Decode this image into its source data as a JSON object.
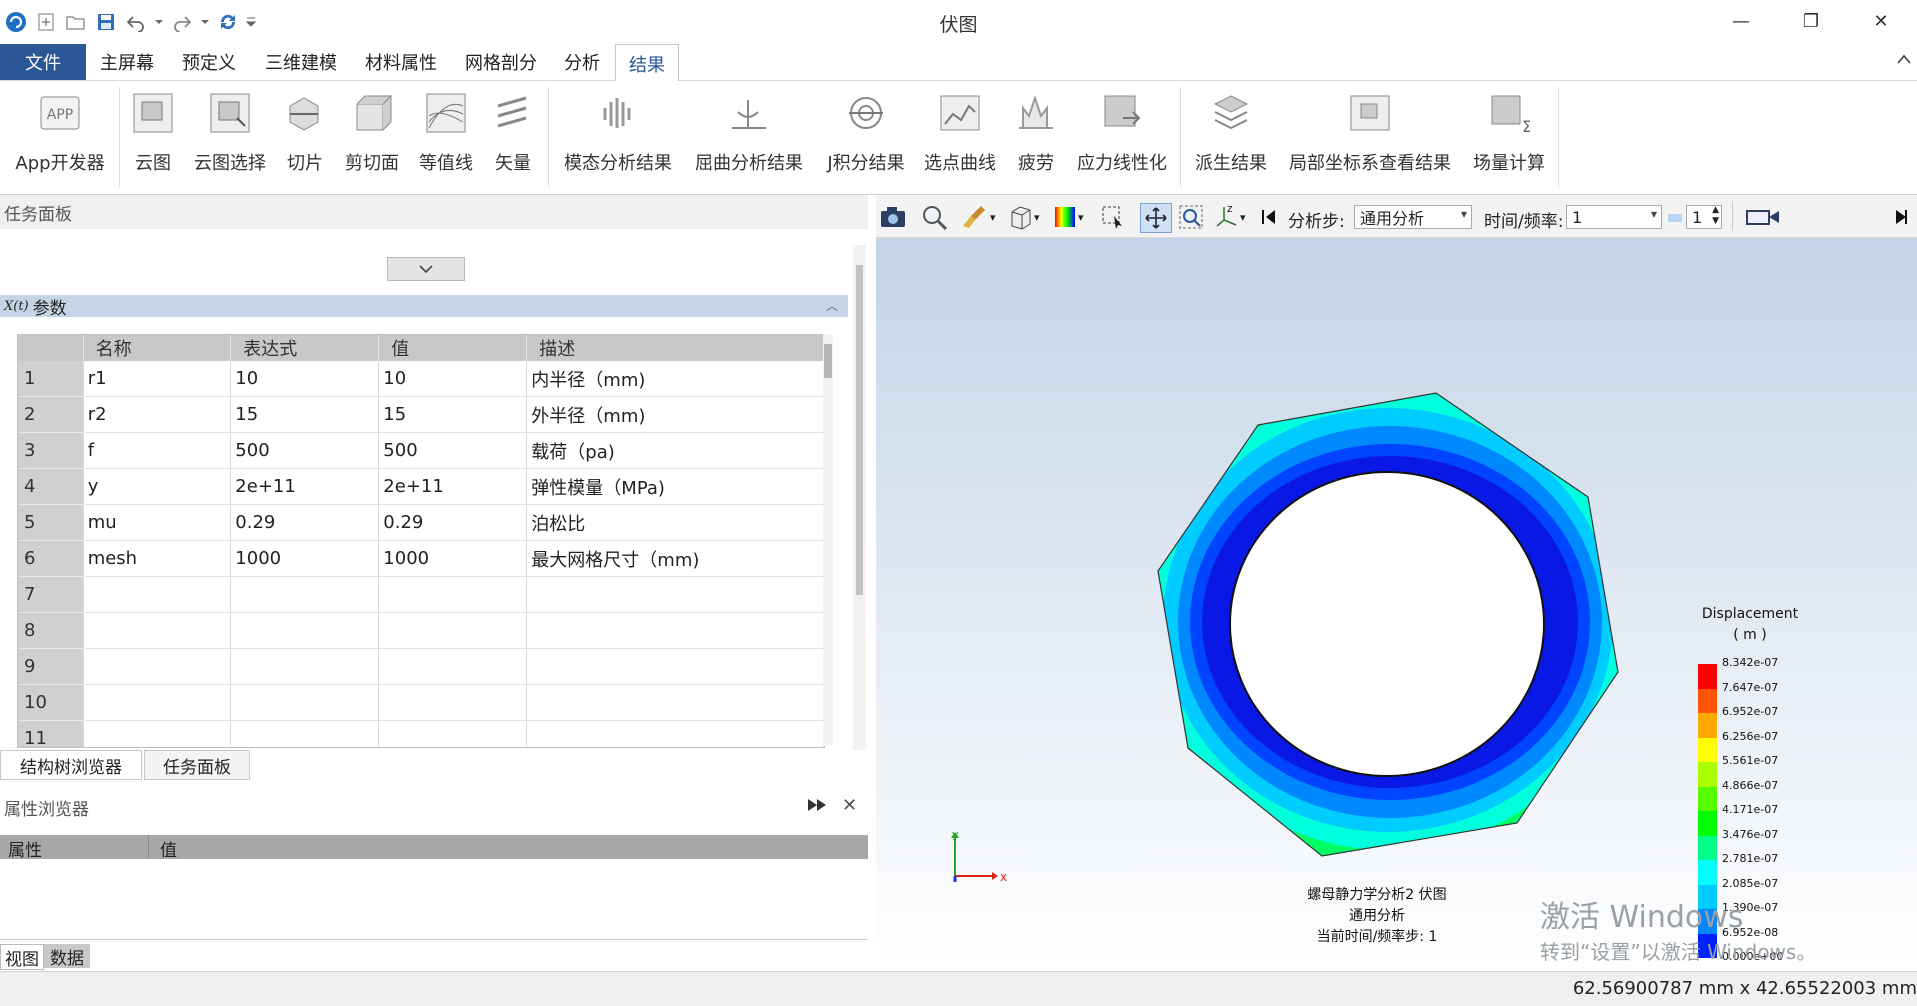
{
  "app": {
    "title": "伏图"
  },
  "window": {
    "minimize": "—",
    "restore": "❐",
    "close": "✕"
  },
  "ribbon_tabs": {
    "file": "文件",
    "items": [
      "主屏幕",
      "预定义",
      "三维建模",
      "材料属性",
      "网格剖分",
      "分析",
      "结果"
    ],
    "active": "结果"
  },
  "ribbon_buttons": [
    "App开发器",
    "云图",
    "云图选择",
    "切片",
    "剪切面",
    "等值线",
    "矢量",
    "模态分析结果",
    "屈曲分析结果",
    "J积分结果",
    "选点曲线",
    "疲劳",
    "应力线性化",
    "派生结果",
    "局部坐标系查看结果",
    "场量计算"
  ],
  "task_panel": {
    "title": "任务面板",
    "param_section": "参数",
    "param_icon_label": "X(t)",
    "columns": [
      "名称",
      "表达式",
      "值",
      "描述"
    ],
    "rows": [
      {
        "n": "1",
        "name": "r1",
        "expr": "10",
        "value": "10",
        "desc": "内半径（mm)"
      },
      {
        "n": "2",
        "name": "r2",
        "expr": "15",
        "value": "15",
        "desc": "外半径（mm)"
      },
      {
        "n": "3",
        "name": "f",
        "expr": "500",
        "value": "500",
        "desc": "载荷（pa)"
      },
      {
        "n": "4",
        "name": "y",
        "expr": "2e+11",
        "value": "2e+11",
        "desc": "弹性模量（MPa)"
      },
      {
        "n": "5",
        "name": "mu",
        "expr": "0.29",
        "value": "0.29",
        "desc": "泊松比"
      },
      {
        "n": "6",
        "name": "mesh",
        "expr": "1000",
        "value": "1000",
        "desc": "最大网格尺寸（mm)"
      },
      {
        "n": "7",
        "name": "",
        "expr": "",
        "value": "",
        "desc": ""
      },
      {
        "n": "8",
        "name": "",
        "expr": "",
        "value": "",
        "desc": ""
      },
      {
        "n": "9",
        "name": "",
        "expr": "",
        "value": "",
        "desc": ""
      },
      {
        "n": "10",
        "name": "",
        "expr": "",
        "value": "",
        "desc": ""
      },
      {
        "n": "11",
        "name": "",
        "expr": "",
        "value": "",
        "desc": ""
      }
    ]
  },
  "bottom_tabs": [
    "结构树浏览器",
    "任务面板"
  ],
  "property_browser": {
    "title": "属性浏览器",
    "col_property": "属性",
    "col_value": "值"
  },
  "view_tabs": [
    "视图",
    "数据"
  ],
  "viewport_toolbar": {
    "step_label": "分析步:",
    "step_value": "通用分析",
    "time_label": "时间/频率:",
    "time_value": "1",
    "spin_value": "1"
  },
  "viewport": {
    "axis_x": "x",
    "axis_y": "y",
    "info_line1": "螺母静力学分析2  伏图",
    "info_line2": "通用分析",
    "info_line3": "当前时间/频率步:  1"
  },
  "legend": {
    "title": "Displacement",
    "unit": "( m )",
    "labels": [
      "8.342e-07",
      "7.647e-07",
      "6.952e-07",
      "6.256e-07",
      "5.561e-07",
      "4.866e-07",
      "4.171e-07",
      "3.476e-07",
      "2.781e-07",
      "2.085e-07",
      "1.390e-07",
      "6.952e-08",
      "0.000e+00"
    ],
    "colors": [
      "#ff0000",
      "#ff5500",
      "#ffaa00",
      "#ffff00",
      "#aaff00",
      "#55ff00",
      "#00ff00",
      "#00ff88",
      "#00ffff",
      "#00ccff",
      "#0088ff",
      "#0022ff"
    ]
  },
  "watermark": {
    "line1": "激活 Windows",
    "line2": "转到“设置”以激活 Windows。"
  },
  "status": {
    "dimensions": "62.56900787 mm x 42.65522003 mm"
  }
}
